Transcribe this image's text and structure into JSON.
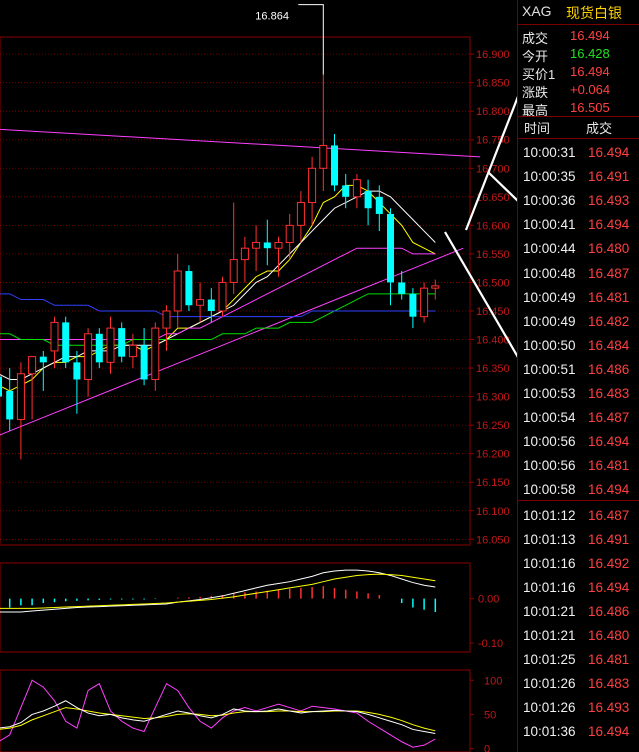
{
  "header": {
    "symbol": "XAG",
    "name": "现货白银"
  },
  "quote": [
    {
      "label": "成交",
      "value": "16.494",
      "color": "#ff4040"
    },
    {
      "label": "今开",
      "value": "16.428",
      "color": "#20e020"
    },
    {
      "label": "买价1",
      "value": "16.494",
      "color": "#ff4040"
    },
    {
      "label": "涨跌",
      "value": "+0.064",
      "color": "#ff4040"
    },
    {
      "label": "最高",
      "value": "16.505",
      "color": "#ff4040"
    }
  ],
  "trades": {
    "header_time": "时间",
    "header_price": "成交",
    "rows": [
      {
        "time": "10:00:31",
        "price": "16.494"
      },
      {
        "time": "10:00:35",
        "price": "16.491"
      },
      {
        "time": "10:00:36",
        "price": "16.493"
      },
      {
        "time": "10:00:41",
        "price": "16.494"
      },
      {
        "time": "10:00:44",
        "price": "16.480"
      },
      {
        "time": "10:00:48",
        "price": "16.487"
      },
      {
        "time": "10:00:49",
        "price": "16.481"
      },
      {
        "time": "10:00:49",
        "price": "16.482"
      },
      {
        "time": "10:00:50",
        "price": "16.484"
      },
      {
        "time": "10:00:51",
        "price": "16.486"
      },
      {
        "time": "10:00:53",
        "price": "16.483"
      },
      {
        "time": "10:00:54",
        "price": "16.487"
      },
      {
        "time": "10:00:56",
        "price": "16.494"
      },
      {
        "time": "10:00:56",
        "price": "16.481"
      },
      {
        "time": "10:00:58",
        "price": "16.494"
      },
      {
        "time": "10:01:12",
        "price": "16.487"
      },
      {
        "time": "10:01:13",
        "price": "16.491"
      },
      {
        "time": "10:01:16",
        "price": "16.492"
      },
      {
        "time": "10:01:16",
        "price": "16.494"
      },
      {
        "time": "10:01:21",
        "price": "16.486"
      },
      {
        "time": "10:01:21",
        "price": "16.480"
      },
      {
        "time": "10:01:25",
        "price": "16.481"
      },
      {
        "time": "10:01:26",
        "price": "16.483"
      },
      {
        "time": "10:01:26",
        "price": "16.493"
      },
      {
        "time": "10:01:36",
        "price": "16.494"
      }
    ]
  },
  "chart_data": [
    {
      "type": "candlestick",
      "ylim": [
        16.04,
        16.93
      ],
      "yticks": [
        "16.050",
        "16.100",
        "16.150",
        "16.200",
        "16.250",
        "16.300",
        "16.350",
        "16.400",
        "16.450",
        "16.500",
        "16.550",
        "16.600",
        "16.650",
        "16.700",
        "16.750",
        "16.800",
        "16.850",
        "16.900"
      ],
      "annotation": "16.864",
      "colors": {
        "up": "#ff3030",
        "down": "#00ffff",
        "grid": "#8b0000",
        "axis_text": "#c01818",
        "annotation": "#ffffff"
      },
      "candles": [
        {
          "o": 16.335,
          "h": 16.37,
          "l": 16.28,
          "c": 16.3
        },
        {
          "o": 16.31,
          "h": 16.35,
          "l": 16.24,
          "c": 16.26
        },
        {
          "o": 16.26,
          "h": 16.36,
          "l": 16.19,
          "c": 16.34
        },
        {
          "o": 16.34,
          "h": 16.37,
          "l": 16.26,
          "c": 16.37
        },
        {
          "o": 16.37,
          "h": 16.38,
          "l": 16.31,
          "c": 16.36
        },
        {
          "o": 16.38,
          "h": 16.44,
          "l": 16.35,
          "c": 16.43
        },
        {
          "o": 16.43,
          "h": 16.44,
          "l": 16.35,
          "c": 16.36
        },
        {
          "o": 16.36,
          "h": 16.38,
          "l": 16.27,
          "c": 16.33
        },
        {
          "o": 16.33,
          "h": 16.42,
          "l": 16.3,
          "c": 16.41
        },
        {
          "o": 16.41,
          "h": 16.42,
          "l": 16.35,
          "c": 16.36
        },
        {
          "o": 16.36,
          "h": 16.44,
          "l": 16.34,
          "c": 16.42
        },
        {
          "o": 16.42,
          "h": 16.43,
          "l": 16.36,
          "c": 16.37
        },
        {
          "o": 16.37,
          "h": 16.41,
          "l": 16.35,
          "c": 16.39
        },
        {
          "o": 16.39,
          "h": 16.42,
          "l": 16.32,
          "c": 16.33
        },
        {
          "o": 16.33,
          "h": 16.43,
          "l": 16.31,
          "c": 16.42
        },
        {
          "o": 16.42,
          "h": 16.46,
          "l": 16.38,
          "c": 16.45
        },
        {
          "o": 16.45,
          "h": 16.55,
          "l": 16.42,
          "c": 16.52
        },
        {
          "o": 16.52,
          "h": 16.53,
          "l": 16.45,
          "c": 16.46
        },
        {
          "o": 16.46,
          "h": 16.5,
          "l": 16.43,
          "c": 16.47
        },
        {
          "o": 16.47,
          "h": 16.49,
          "l": 16.43,
          "c": 16.45
        },
        {
          "o": 16.45,
          "h": 16.51,
          "l": 16.44,
          "c": 16.5
        },
        {
          "o": 16.5,
          "h": 16.64,
          "l": 16.48,
          "c": 16.54
        },
        {
          "o": 16.54,
          "h": 16.58,
          "l": 16.5,
          "c": 16.56
        },
        {
          "o": 16.56,
          "h": 16.6,
          "l": 16.52,
          "c": 16.57
        },
        {
          "o": 16.57,
          "h": 16.61,
          "l": 16.53,
          "c": 16.56
        },
        {
          "o": 16.56,
          "h": 16.58,
          "l": 16.51,
          "c": 16.57
        },
        {
          "o": 16.57,
          "h": 16.62,
          "l": 16.54,
          "c": 16.6
        },
        {
          "o": 16.6,
          "h": 16.66,
          "l": 16.57,
          "c": 16.64
        },
        {
          "o": 16.64,
          "h": 16.72,
          "l": 16.6,
          "c": 16.7
        },
        {
          "o": 16.7,
          "h": 16.864,
          "l": 16.66,
          "c": 16.74
        },
        {
          "o": 16.74,
          "h": 16.76,
          "l": 16.66,
          "c": 16.67
        },
        {
          "o": 16.67,
          "h": 16.69,
          "l": 16.63,
          "c": 16.65
        },
        {
          "o": 16.65,
          "h": 16.69,
          "l": 16.63,
          "c": 16.68
        },
        {
          "o": 16.66,
          "h": 16.68,
          "l": 16.6,
          "c": 16.63
        },
        {
          "o": 16.65,
          "h": 16.67,
          "l": 16.59,
          "c": 16.62
        },
        {
          "o": 16.62,
          "h": 16.63,
          "l": 16.46,
          "c": 16.5
        },
        {
          "o": 16.5,
          "h": 16.52,
          "l": 16.47,
          "c": 16.48
        },
        {
          "o": 16.48,
          "h": 16.49,
          "l": 16.42,
          "c": 16.44
        },
        {
          "o": 16.44,
          "h": 16.5,
          "l": 16.43,
          "c": 16.49
        },
        {
          "o": 16.49,
          "h": 16.505,
          "l": 16.47,
          "c": 16.494
        }
      ],
      "ma_lines": [
        {
          "color": "#ffff00",
          "values": [
            16.32,
            16.31,
            16.32,
            16.33,
            16.35,
            16.36,
            16.36,
            16.37,
            16.37,
            16.38,
            16.39,
            16.39,
            16.39,
            16.38,
            16.39,
            16.4,
            16.42,
            16.42,
            16.43,
            16.44,
            16.45,
            16.47,
            16.49,
            16.51,
            16.52,
            16.52,
            16.54,
            16.57,
            16.6,
            16.64,
            16.65,
            16.67,
            16.67,
            16.66,
            16.64,
            16.62,
            16.6,
            16.57,
            16.56,
            16.55
          ]
        },
        {
          "color": "#ffffff",
          "values": [
            16.34,
            16.33,
            16.33,
            16.34,
            16.35,
            16.36,
            16.37,
            16.37,
            16.38,
            16.38,
            16.38,
            16.39,
            16.39,
            16.39,
            16.39,
            16.4,
            16.41,
            16.42,
            16.43,
            16.44,
            16.45,
            16.46,
            16.48,
            16.5,
            16.51,
            16.53,
            16.55,
            16.57,
            16.59,
            16.61,
            16.63,
            16.64,
            16.65,
            16.66,
            16.66,
            16.65,
            16.63,
            16.61,
            16.59,
            16.57
          ]
        },
        {
          "color": "#ff40ff",
          "values": [
            16.4,
            16.4,
            16.4,
            16.4,
            16.4,
            16.4,
            16.4,
            16.4,
            16.4,
            16.4,
            16.4,
            16.4,
            16.4,
            16.4,
            16.4,
            16.41,
            16.41,
            16.42,
            16.42,
            16.43,
            16.44,
            16.45,
            16.46,
            16.47,
            16.48,
            16.49,
            16.5,
            16.51,
            16.52,
            16.53,
            16.54,
            16.55,
            16.56,
            16.56,
            16.56,
            16.56,
            16.56,
            16.55,
            16.55,
            16.55
          ]
        },
        {
          "color": "#00e000",
          "values": [
            16.41,
            16.41,
            16.4,
            16.4,
            16.4,
            16.39,
            16.39,
            16.39,
            16.39,
            16.39,
            16.39,
            16.39,
            16.4,
            16.4,
            16.4,
            16.4,
            16.4,
            16.4,
            16.4,
            16.4,
            16.41,
            16.41,
            16.41,
            16.42,
            16.42,
            16.42,
            16.43,
            16.43,
            16.43,
            16.44,
            16.45,
            16.46,
            16.47,
            16.48,
            16.48,
            16.48,
            16.48,
            16.48,
            16.48,
            16.48
          ]
        },
        {
          "color": "#3040ff",
          "values": [
            16.48,
            16.48,
            16.47,
            16.47,
            16.47,
            16.46,
            16.46,
            16.46,
            16.46,
            16.45,
            16.45,
            16.45,
            16.45,
            16.45,
            16.45,
            16.44,
            16.44,
            16.44,
            16.44,
            16.44,
            16.44,
            16.44,
            16.44,
            16.44,
            16.44,
            16.44,
            16.44,
            16.44,
            16.45,
            16.45,
            16.45,
            16.45,
            16.45,
            16.45,
            16.45,
            16.45,
            16.45,
            16.45,
            16.45,
            16.45
          ]
        }
      ],
      "trendlines": [
        {
          "color": "#ff40ff",
          "x1": -1.5,
          "y1": 16.22,
          "x2": 41.5,
          "y2": 16.56
        },
        {
          "color": "#ff40ff",
          "x1": -1.5,
          "y1": 16.77,
          "x2": 43,
          "y2": 16.72
        }
      ]
    },
    {
      "type": "macd",
      "ylim": [
        -0.12,
        0.08
      ],
      "yticks": [
        "0.00",
        "-0.10"
      ],
      "hist": [
        -0.02,
        -0.02,
        -0.015,
        -0.015,
        -0.01,
        -0.008,
        -0.006,
        -0.005,
        -0.004,
        -0.003,
        -0.002,
        -0.002,
        -0.002,
        -0.002,
        -0.001,
        0.0,
        0.002,
        0.003,
        0.004,
        0.006,
        0.008,
        0.011,
        0.014,
        0.016,
        0.018,
        0.02,
        0.022,
        0.024,
        0.026,
        0.028,
        0.024,
        0.02,
        0.016,
        0.012,
        0.008,
        0.0,
        -0.01,
        -0.02,
        -0.025,
        -0.03
      ],
      "dif": [
        -0.03,
        -0.03,
        -0.03,
        -0.028,
        -0.026,
        -0.024,
        -0.022,
        -0.02,
        -0.019,
        -0.018,
        -0.017,
        -0.016,
        -0.015,
        -0.014,
        -0.013,
        -0.012,
        -0.008,
        -0.005,
        -0.002,
        0.002,
        0.006,
        0.012,
        0.018,
        0.024,
        0.03,
        0.034,
        0.038,
        0.044,
        0.05,
        0.058,
        0.062,
        0.064,
        0.064,
        0.062,
        0.058,
        0.052,
        0.044,
        0.036,
        0.03,
        0.026
      ],
      "dea": [
        -0.022,
        -0.022,
        -0.022,
        -0.022,
        -0.021,
        -0.02,
        -0.019,
        -0.018,
        -0.017,
        -0.016,
        -0.015,
        -0.014,
        -0.013,
        -0.012,
        -0.011,
        -0.01,
        -0.008,
        -0.006,
        -0.004,
        -0.002,
        0.001,
        0.004,
        0.008,
        0.012,
        0.016,
        0.02,
        0.024,
        0.028,
        0.032,
        0.038,
        0.044,
        0.048,
        0.052,
        0.054,
        0.055,
        0.054,
        0.052,
        0.048,
        0.044,
        0.04
      ]
    },
    {
      "type": "kdj",
      "ylim": [
        -5,
        115
      ],
      "yticks": [
        "100",
        "50",
        "0"
      ],
      "k": [
        30,
        32,
        38,
        50,
        55,
        62,
        70,
        60,
        52,
        48,
        50,
        45,
        42,
        40,
        45,
        50,
        55,
        52,
        48,
        45,
        50,
        58,
        55,
        54,
        55,
        58,
        55,
        52,
        54,
        55,
        56,
        55,
        54,
        50,
        45,
        40,
        35,
        28,
        25,
        22
      ],
      "d": [
        28,
        30,
        34,
        42,
        48,
        54,
        60,
        58,
        55,
        52,
        50,
        48,
        46,
        44,
        45,
        47,
        50,
        51,
        50,
        48,
        49,
        52,
        54,
        54,
        54,
        55,
        55,
        54,
        54,
        54,
        55,
        55,
        55,
        53,
        50,
        46,
        41,
        35,
        30,
        26
      ],
      "j": [
        10,
        20,
        60,
        100,
        90,
        70,
        40,
        30,
        85,
        95,
        55,
        40,
        30,
        25,
        60,
        95,
        85,
        60,
        40,
        30,
        45,
        55,
        60,
        55,
        60,
        65,
        60,
        55,
        62,
        60,
        58,
        55,
        52,
        40,
        30,
        20,
        10,
        2,
        5,
        14
      ],
      "colors": {
        "k": "#ffffff",
        "d": "#ffff00",
        "j": "#ff40ff"
      }
    }
  ]
}
